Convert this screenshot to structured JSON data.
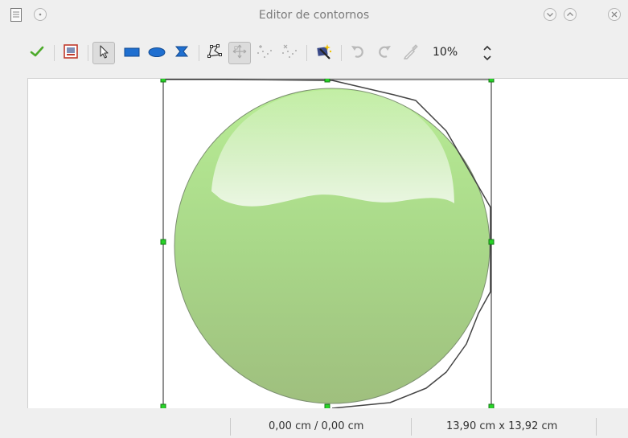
{
  "window": {
    "title": "Editor de contornos"
  },
  "toolbar": {
    "zoom_value": "10%",
    "buttons": [
      {
        "name": "apply-button",
        "icon": "check-icon"
      },
      {
        "name": "workspace-button",
        "icon": "workspace-icon"
      },
      {
        "name": "select-button",
        "icon": "pointer-arrow-icon",
        "pressed": true
      },
      {
        "name": "rectangle-button",
        "icon": "rectangle-icon"
      },
      {
        "name": "ellipse-button",
        "icon": "ellipse-icon"
      },
      {
        "name": "polygon-button",
        "icon": "polygon-icon"
      },
      {
        "name": "edit-points-button",
        "icon": "edit-points-icon"
      },
      {
        "name": "move-points-button",
        "icon": "move-points-icon",
        "pressed": true
      },
      {
        "name": "insert-points-button",
        "icon": "insert-points-icon"
      },
      {
        "name": "delete-points-button",
        "icon": "delete-points-icon"
      },
      {
        "name": "autocontour-button",
        "icon": "magic-wand-icon"
      },
      {
        "name": "undo-button",
        "icon": "undo-icon"
      },
      {
        "name": "redo-button",
        "icon": "redo-icon"
      },
      {
        "name": "pipette-button",
        "icon": "pipette-icon"
      }
    ]
  },
  "status": {
    "position": "0,00 cm / 0,00 cm",
    "size": "13,90 cm x 13,92 cm"
  },
  "colors": {
    "handle": "#27d327",
    "sphere_top": "#b8ec95",
    "sphere_bottom": "#9fbf7e"
  }
}
